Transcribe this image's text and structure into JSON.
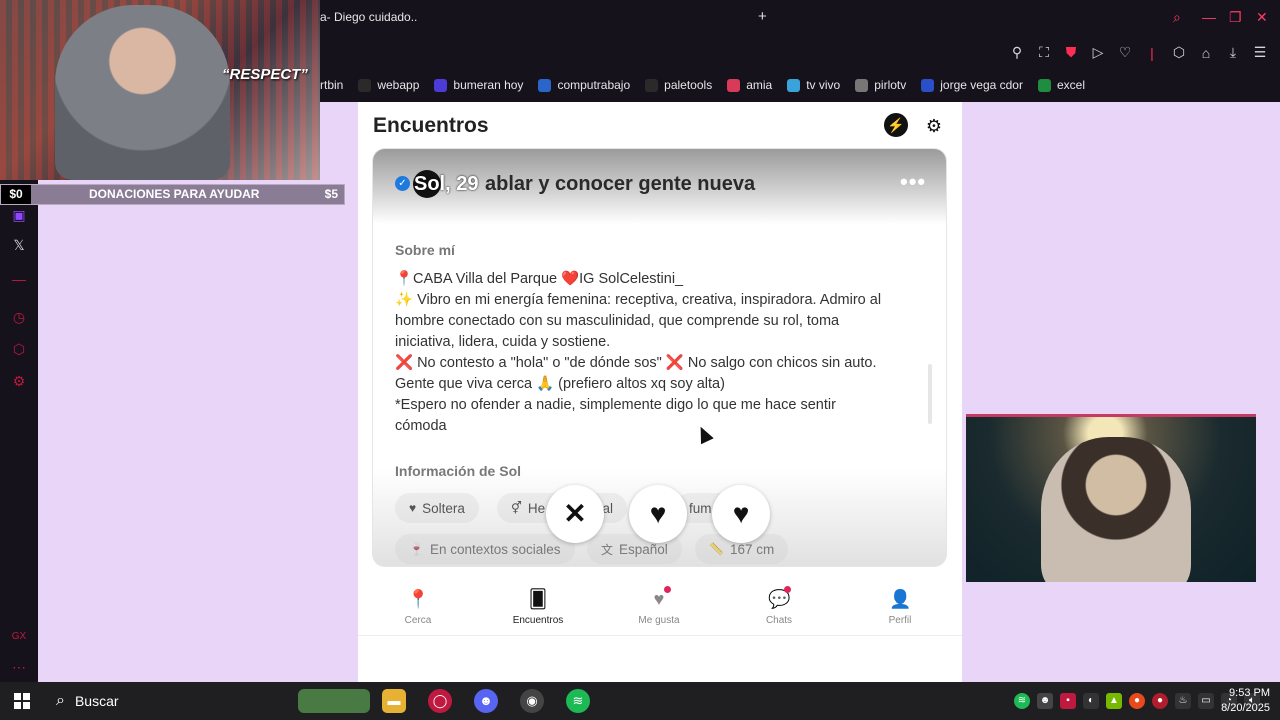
{
  "browser": {
    "tab_title": "a- Diego cuidado..",
    "tab_add": "+",
    "bookmarks": [
      {
        "label": "rtbin",
        "color": "#15121c"
      },
      {
        "label": "webapp",
        "color": "#2a2a2a"
      },
      {
        "label": "bumeran hoy",
        "color": "#4c3bd6"
      },
      {
        "label": "computrabajo",
        "color": "#2a66c9"
      },
      {
        "label": "paletools",
        "color": "#2a2a2a"
      },
      {
        "label": "amia",
        "color": "#d93a5a"
      },
      {
        "label": "tv vivo",
        "color": "#3aa3d9"
      },
      {
        "label": "pirlotv",
        "color": "#777777"
      },
      {
        "label": "jorge vega cdor",
        "color": "#2a4fc9"
      },
      {
        "label": "excel",
        "color": "#1e8e3e"
      }
    ]
  },
  "stream": {
    "cam_text": "“RESPECT”",
    "donation_left": "$0",
    "donation_label": "DONACIONES PARA AYUDAR",
    "donation_right": "$5"
  },
  "app": {
    "title": "Encuentros",
    "profile": {
      "name_age": "Sol, 29",
      "headline": "ablar y conocer gente nueva",
      "more": "•••",
      "about_label": "Sobre mí",
      "bio_lines": [
        "📍CABA Villa del Parque ❤️IG SolCelestini_",
        "✨ Vibro en mi energía femenina: receptiva, creativa, inspiradora. Admiro al",
        "hombre conectado con su masculinidad, que comprende su rol, toma",
        "iniciativa, lidera, cuida y sostiene.",
        "❌ No contesto a \"hola\" o \"de dónde sos\" ❌ No salgo con chicos sin auto.",
        "Gente que viva cerca 🙏 (prefiero altos xq soy alta)",
        "*Espero no ofender a nadie, simplemente digo lo que me hace sentir",
        "cómoda"
      ],
      "info_label": "Información de Sol",
      "chips": [
        {
          "icon": "♥",
          "label": "Soltera"
        },
        {
          "icon": "⚥",
          "label": "He"
        },
        {
          "icon": "",
          "label": "al"
        },
        {
          "icon": "",
          "label": "fum"
        },
        {
          "icon": "🍷",
          "label": "En contextos sociales"
        },
        {
          "icon": "文",
          "label": "Español"
        },
        {
          "icon": "📏",
          "label": "167 cm"
        }
      ]
    },
    "actions": {
      "dislike": "✕",
      "superlike": "♥",
      "like": "♥"
    },
    "nav": [
      {
        "label": "Cerca",
        "icon": "📍"
      },
      {
        "label": "Encuentros",
        "icon": "🂠"
      },
      {
        "label": "Me gusta",
        "icon": "♥"
      },
      {
        "label": "Chats",
        "icon": "💬"
      },
      {
        "label": "Perfil",
        "icon": "👤"
      }
    ]
  },
  "taskbar": {
    "search_placeholder": "Buscar",
    "time": "9:53 PM",
    "date": "8/20/2025"
  }
}
